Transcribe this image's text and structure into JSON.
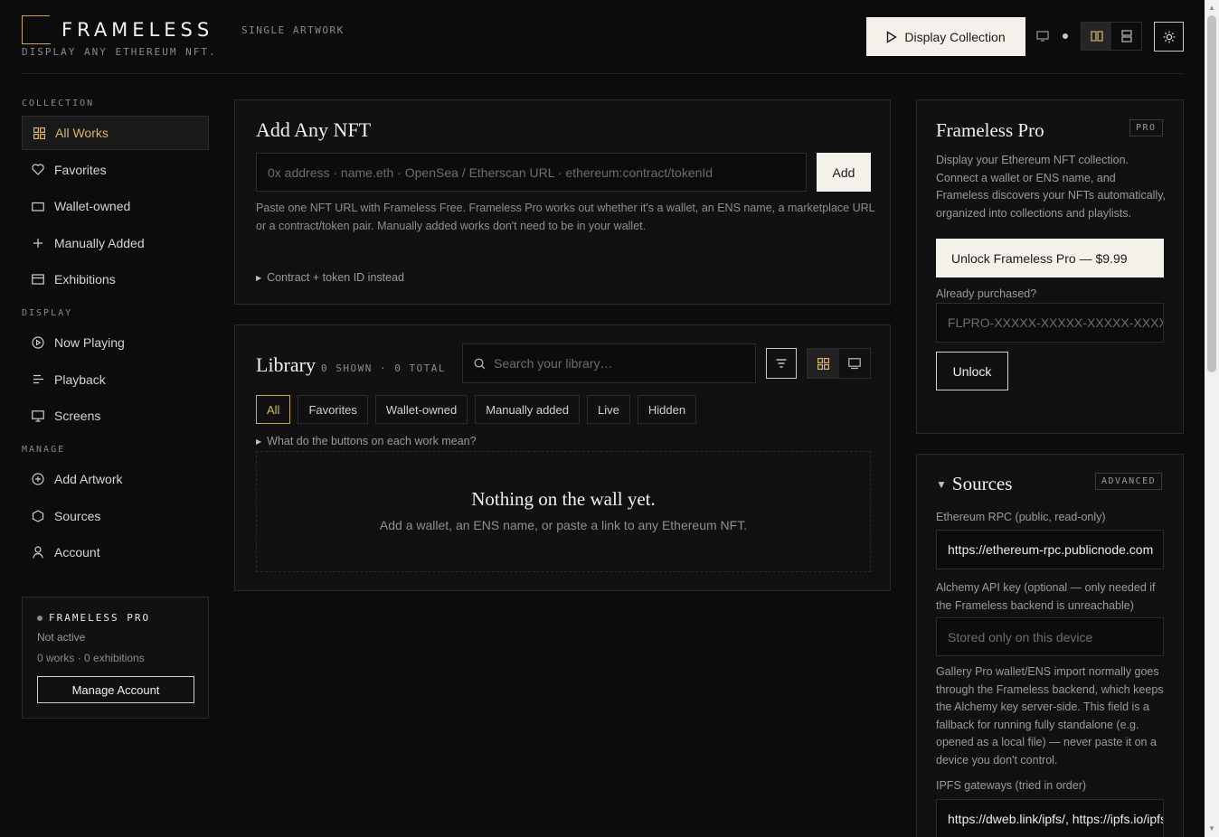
{
  "header": {
    "brand": "FRAMELESS",
    "mode": "SINGLE ARTWORK",
    "tagline": "DISPLAY ANY ETHEREUM NFT.",
    "display_button": "Display Collection"
  },
  "sidebar": {
    "sections": [
      {
        "title": "COLLECTION",
        "items": [
          {
            "label": "All Works",
            "icon": "grid-icon",
            "active": true
          },
          {
            "label": "Favorites",
            "icon": "heart-icon"
          },
          {
            "label": "Wallet-owned",
            "icon": "wallet-icon"
          },
          {
            "label": "Manually Added",
            "icon": "plus-icon"
          },
          {
            "label": "Exhibitions",
            "icon": "exhibition-icon"
          }
        ]
      },
      {
        "title": "DISPLAY",
        "items": [
          {
            "label": "Now Playing",
            "icon": "play-circle-icon"
          },
          {
            "label": "Playback",
            "icon": "playback-icon"
          },
          {
            "label": "Screens",
            "icon": "monitor-icon"
          }
        ]
      },
      {
        "title": "MANAGE",
        "items": [
          {
            "label": "Add Artwork",
            "icon": "plus-circle-icon"
          },
          {
            "label": "Sources",
            "icon": "hexagon-icon"
          },
          {
            "label": "Account",
            "icon": "user-icon"
          }
        ]
      }
    ],
    "pro_card": {
      "title": "FRAMELESS PRO",
      "status": "Not active",
      "counts": "0 works · 0 exhibitions",
      "button": "Manage Account"
    }
  },
  "add_nft": {
    "title": "Add Any NFT",
    "placeholder": "0x address · name.eth · OpenSea / Etherscan URL · ethereum:contract/tokenId",
    "button": "Add",
    "help": "Paste one NFT URL with Frameless Free. Frameless Pro works out whether it's a wallet, an ENS name, a marketplace URL or a contract/token pair. Manually added works don't need to be in your wallet.",
    "disclosure": "Contract + token ID instead"
  },
  "library": {
    "title": "Library",
    "counts": "0 SHOWN · 0 TOTAL",
    "search_placeholder": "Search your library…",
    "filters": [
      "All",
      "Favorites",
      "Wallet-owned",
      "Manually added",
      "Live",
      "Hidden"
    ],
    "active_filter": "All",
    "disclosure": "What do the buttons on each work mean?",
    "empty_title": "Nothing on the wall yet.",
    "empty_sub": "Add a wallet, an ENS name, or paste a link to any Ethereum NFT."
  },
  "pro_panel": {
    "title": "Frameless Pro",
    "badge": "PRO",
    "description": "Display your Ethereum NFT collection. Connect a wallet or ENS name, and Frameless discovers your NFTs automatically, organized into collections and playlists.",
    "unlock_button": "Unlock Frameless Pro — $9.99",
    "purchased_label": "Already purchased?",
    "license_placeholder": "FLPRO-XXXXX-XXXXX-XXXXX-XXXXX",
    "unlock_label": "Unlock"
  },
  "sources": {
    "title": "Sources",
    "badge": "ADVANCED",
    "rpc_label": "Ethereum RPC (public, read-only)",
    "rpc_value": "https://ethereum-rpc.publicnode.com",
    "alchemy_label": "Alchemy API key (optional — only needed if the Frameless backend is unreachable)",
    "alchemy_placeholder": "Stored only on this device",
    "alchemy_help": "Gallery Pro wallet/ENS import normally goes through the Frameless backend, which keeps the Alchemy key server-side. This field is a fallback for running fully standalone (e.g. opened as a local file) — never paste it on a device you don't control.",
    "ipfs_label": "IPFS gateways (tried in order)",
    "ipfs_value": "https://dweb.link/ipfs/, https://ipfs.io/ipfs/"
  },
  "colors": {
    "accent": "#c9a85c",
    "background": "#0c0c0d",
    "panel": "#111112",
    "primary_button": "#f3f1ea"
  }
}
